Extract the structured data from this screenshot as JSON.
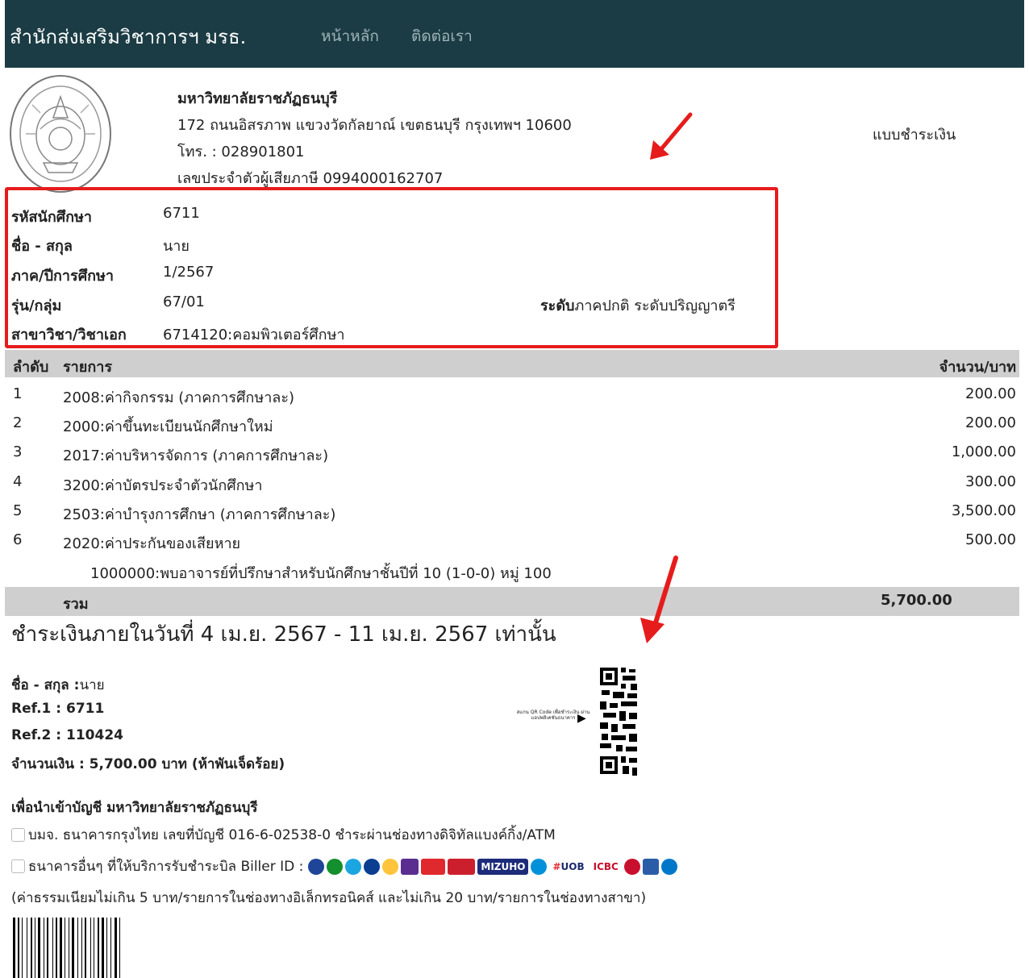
{
  "header": {
    "brand": "สำนักส่งเสริมวิชาการฯ มรธ.",
    "nav": [
      "หน้าหลัก",
      "ติดต่อเรา"
    ]
  },
  "university": {
    "name": "มหาวิทยาลัยราชภัฏธนบุรี",
    "address": "172 ถนนอิสรภาพ แขวงวัดกัลยาณ์ เขตธนบุรี กรุงเทพฯ 10600",
    "phone": "โทร. : 028901801",
    "tax_id": "เลขประจำตัวผู้เสียภาษี 0994000162707"
  },
  "payment_type": "แบบชำระเงิน",
  "student": {
    "fields": [
      {
        "label": "รหัสนักศึกษา",
        "value": "6711"
      },
      {
        "label": "ชื่อ - สกุล",
        "value": "นาย"
      },
      {
        "label": "ภาค/ปีการศึกษา",
        "value": "1/2567"
      },
      {
        "label": "รุ่น/กลุ่ม",
        "value": "67/01"
      },
      {
        "label": "สาขาวิชา/วิชาเอก",
        "value": "6714120:คอมพิวเตอร์ศึกษา"
      }
    ],
    "level_label": "ระดับ",
    "level_value": "ภาคปกติ ระดับปริญญาตรี"
  },
  "table": {
    "headers": {
      "no": "ลำดับ",
      "item": "รายการ",
      "amount": "จำนวน/บาท"
    },
    "rows": [
      {
        "no": "1",
        "item": "2008:ค่ากิจกรรม (ภาคการศึกษาละ)",
        "amount": "200.00"
      },
      {
        "no": "2",
        "item": "2000:ค่าขึ้นทะเบียนนักศึกษาใหม่",
        "amount": "200.00"
      },
      {
        "no": "3",
        "item": "2017:ค่าบริหารจัดการ (ภาคการศึกษาละ)",
        "amount": "1,000.00"
      },
      {
        "no": "4",
        "item": "3200:ค่าบัตรประจำตัวนักศึกษา",
        "amount": "300.00"
      },
      {
        "no": "5",
        "item": "2503:ค่าบำรุงการศึกษา (ภาคการศึกษาละ)",
        "amount": "3,500.00"
      },
      {
        "no": "6",
        "item": "2020:ค่าประกันของเสียหาย",
        "amount": "500.00"
      }
    ],
    "note": "1000000:พบอาจารย์ที่ปรึกษาสำหรับนักศึกษาชั้นปีที่ 10 (1-0-0) หมู่ 100",
    "total_label": "รวม",
    "total_amount": "5,700.00"
  },
  "deadline": "ชำระเงินภายในวันที่ 4 เม.ย. 2567 - 11 เม.ย. 2567 เท่านั้น",
  "payment": {
    "name_label": "ชื่อ - สกุล :",
    "name_value": "นาย",
    "ref1": "Ref.1 : 6711",
    "ref2": "Ref.2 : 110424",
    "amount": "จำนวนเงิน : 5,700.00 บาท (ห้าพันเจ็ดร้อย)"
  },
  "qr_hint": "สแกน QR Code เพื่อชำระเงิน ผ่านแอปพลิเคชันธนาคาร",
  "account_title": "เพื่อนำเข้าบัญชี มหาวิทยาลัยราชภัฏธนบุรี",
  "options": [
    "บมจ. ธนาคารกรุงไทย เลขที่บัญชี 016-6-02538-0 ชำระผ่านช่องทางดิจิทัลแบงค์กิ้ง/ATM",
    "ธนาคารอื่นๆ ที่ให้บริการรับชำระบิล Biller ID :"
  ],
  "bank_logos": {
    "mizuho": "MIZUHO",
    "uob": "UOB",
    "icbc": "ICBC"
  },
  "fee_note": "(ค่าธรรมเนียมไม่เกิน 5 บาท/รายการในช่องทางอิเล็กทรอนิคส์ และไม่เกิน 20 บาท/รายการในช่องทางสาขา)",
  "colors": {
    "header_bg": "#1b3c44",
    "highlight": "#e61c1c",
    "table_header_bg": "#cfcfcf"
  }
}
